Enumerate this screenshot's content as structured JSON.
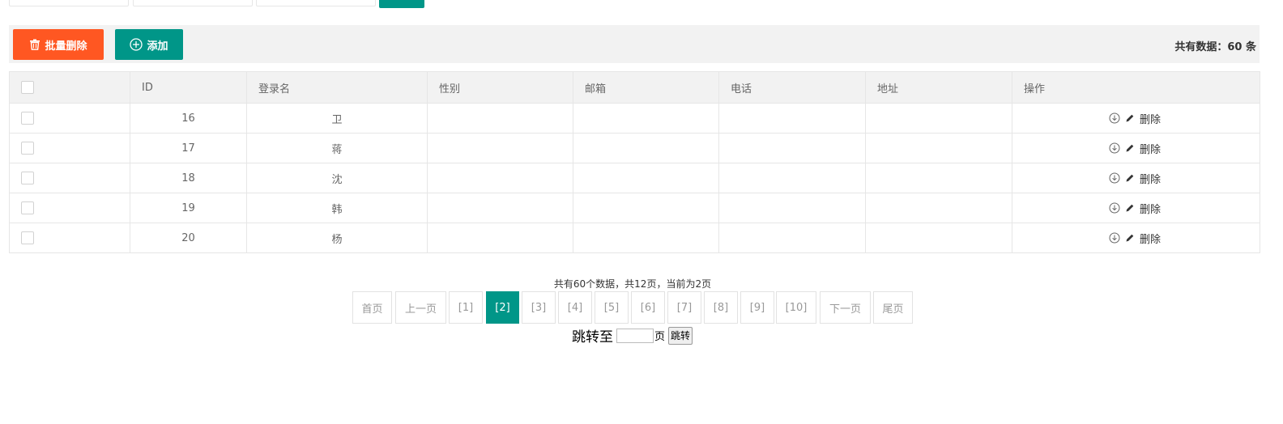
{
  "search": {
    "fields": [
      {
        "placeholder": "",
        "value": ""
      },
      {
        "placeholder": "",
        "value": ""
      },
      {
        "placeholder": "",
        "value": ""
      }
    ]
  },
  "toolbar": {
    "batch_delete_label": "批量删除",
    "add_label": "添加",
    "total_text": "共有数据：60 条"
  },
  "table": {
    "headers": [
      "",
      "ID",
      "登录名",
      "性别",
      "邮箱",
      "电话",
      "地址",
      "操作"
    ],
    "rows": [
      {
        "id": "16",
        "login": "卫",
        "gender": "",
        "email": "",
        "phone": "",
        "address": "",
        "op_delete": "删除"
      },
      {
        "id": "17",
        "login": "蒋",
        "gender": "",
        "email": "",
        "phone": "",
        "address": "",
        "op_delete": "删除"
      },
      {
        "id": "18",
        "login": "沈",
        "gender": "",
        "email": "",
        "phone": "",
        "address": "",
        "op_delete": "删除"
      },
      {
        "id": "19",
        "login": "韩",
        "gender": "",
        "email": "",
        "phone": "",
        "address": "",
        "op_delete": "删除"
      },
      {
        "id": "20",
        "login": "杨",
        "gender": "",
        "email": "",
        "phone": "",
        "address": "",
        "op_delete": "删除"
      }
    ]
  },
  "pagination": {
    "info": "共有60个数据，共12页，当前为2页",
    "first": "首页",
    "prev": "上一页",
    "pages": [
      "[1]",
      "[2]",
      "[3]",
      "[4]",
      "[5]",
      "[6]",
      "[7]",
      "[8]",
      "[9]",
      "[10]"
    ],
    "current": "[2]",
    "next": "下一页",
    "last": "尾页",
    "jump_label": "跳转至",
    "jump_unit": "页",
    "jump_button": "跳转"
  },
  "colors": {
    "danger": "#ff5722",
    "primary": "#009688",
    "header_bg": "#f2f2f2",
    "border": "#e6e6e6"
  },
  "icons": {
    "batch_delete": "trash-icon",
    "add": "plus-circle-icon",
    "row_op_1": "download-circle-icon",
    "row_op_2": "pencil-icon"
  }
}
